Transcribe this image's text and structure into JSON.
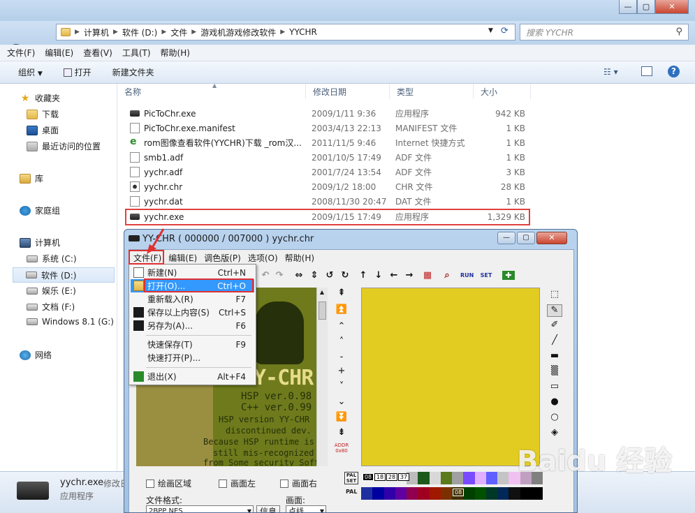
{
  "explorer": {
    "breadcrumb": [
      "计算机",
      "软件 (D:)",
      "文件",
      "游戏机游戏修改软件",
      "YYCHR"
    ],
    "search_placeholder": "搜索 YYCHR",
    "menu": [
      "文件(F)",
      "编辑(E)",
      "查看(V)",
      "工具(T)",
      "帮助(H)"
    ],
    "commands": {
      "organize": "组织",
      "open": "打开",
      "new_folder": "新建文件夹"
    },
    "nav": {
      "favorites": "收藏夹",
      "downloads": "下载",
      "desktop": "桌面",
      "recent": "最近访问的位置",
      "libraries": "库",
      "homegroup": "家庭组",
      "computer": "计算机",
      "drive_c": "系统 (C:)",
      "drive_d": "软件 (D:)",
      "drive_e": "娱乐 (E:)",
      "drive_f": "文档 (F:)",
      "drive_g": "Windows 8.1 (G:)",
      "network": "网络"
    },
    "columns": {
      "name": "名称",
      "date": "修改日期",
      "type": "类型",
      "size": "大小"
    },
    "files": [
      {
        "name": "PicToChr.exe",
        "date": "2009/1/11 9:36",
        "type": "应用程序",
        "size": "942 KB",
        "icon": "exe-icon"
      },
      {
        "name": "PicToChr.exe.manifest",
        "date": "2003/4/13 22:13",
        "type": "MANIFEST 文件",
        "size": "1 KB",
        "icon": "file-icon"
      },
      {
        "name": "rom图像查看软件(YYCHR)下载 _rom汉...",
        "date": "2011/11/5 9:46",
        "type": "Internet 快捷方式",
        "size": "1 KB",
        "icon": "url-icon"
      },
      {
        "name": "smb1.adf",
        "date": "2001/10/5 17:49",
        "type": "ADF 文件",
        "size": "1 KB",
        "icon": "file-icon"
      },
      {
        "name": "yychr.adf",
        "date": "2001/7/24 13:54",
        "type": "ADF 文件",
        "size": "3 KB",
        "icon": "file-icon"
      },
      {
        "name": "yychr.chr",
        "date": "2009/1/2 18:00",
        "type": "CHR 文件",
        "size": "28 KB",
        "icon": "chr-icon"
      },
      {
        "name": "yychr.dat",
        "date": "2008/11/30 20:47",
        "type": "DAT 文件",
        "size": "1 KB",
        "icon": "file-icon"
      },
      {
        "name": "yychr.exe",
        "date": "2009/1/15 17:49",
        "type": "应用程序",
        "size": "1,329 KB",
        "icon": "exe-icon"
      }
    ],
    "status": {
      "name": "yychr.exe",
      "modified_label": "修改日",
      "type": "应用程序"
    }
  },
  "yychr": {
    "title": "YY-CHR ( 000000 / 007000 ) yychr.chr",
    "menu": [
      "文件(F)",
      "编辑(E)",
      "调色版(P)",
      "选项(O)",
      "帮助(H)"
    ],
    "file_menu": [
      {
        "label": "新建(N)",
        "shortcut": "Ctrl+N",
        "icon": "new-icon"
      },
      {
        "label": "打开(O)...",
        "shortcut": "Ctrl+O",
        "icon": "open-folder-icon",
        "selected": true
      },
      {
        "label": "重新载入(R)",
        "shortcut": "F7",
        "icon": ""
      },
      {
        "label": "保存以上内容(S)",
        "shortcut": "Ctrl+S",
        "icon": "save-icon"
      },
      {
        "label": "另存为(A)...",
        "shortcut": "F6",
        "icon": "save-as-icon"
      },
      {
        "label": "快速保存(T)",
        "shortcut": "F9",
        "icon": "",
        "sep_before": true
      },
      {
        "label": "快速打开(P)...",
        "shortcut": "",
        "icon": ""
      },
      {
        "label": "退出(X)",
        "shortcut": "Alt+F4",
        "icon": "exit-icon",
        "sep_before": true
      }
    ],
    "canvas_text": [
      "Y-CHR",
      "HSP  ver.0.98",
      "C++  ver.0.99",
      "HSP version YY-CHR",
      "discontinued dev.",
      "Because HSP runtime is",
      "still mis-recognized",
      "from Some security Soft"
    ],
    "addr_label": "ADDR",
    "addr_value": "0x80",
    "checkboxes": {
      "draw_area": "绘画区域",
      "screen_left": "画面左",
      "screen_right": "画面右"
    },
    "format_label": "文件格式:",
    "format_value": "2BPP NES",
    "info_button": "信息",
    "screen_label": "画面:",
    "screen_value": "点线",
    "pal_set": "PAL SET",
    "pal": "PAL",
    "pal_indices": [
      "08",
      "18",
      "28",
      "37"
    ],
    "pal_index_bottom": "08",
    "colors": {
      "row1": [
        "#000000",
        "#ffffff",
        "#7c7c7c",
        "#ff8c2c",
        "#bcbcbc",
        "#1c5a1c",
        "#d8d8d8",
        "#5a7a1c",
        "#a0a0a0",
        "#7a4aff",
        "#e0b0ff",
        "#6060ff",
        "#c4c4c4",
        "#f0c0f0",
        "#c0a0c0",
        "#808080"
      ],
      "row2": [
        "#2030a0",
        "#0000a0",
        "#3000a8",
        "#6000a0",
        "#900050",
        "#a00020",
        "#a01800",
        "#7c3000",
        "#403000",
        "#004000",
        "#005000",
        "#003828",
        "#002858",
        "#101010",
        "#000000",
        "#000000"
      ],
      "canvas_bg": "#6e7a1c",
      "editor_bg": "#e3cc22",
      "highlight": "#e03030",
      "menu_selected": "#3399ff"
    },
    "watermark": "Baidu 经验"
  }
}
